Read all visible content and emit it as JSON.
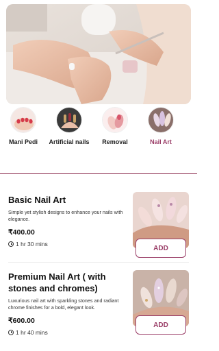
{
  "categories": [
    {
      "label": "Mani Pedi",
      "active": false
    },
    {
      "label": "Artificial nails",
      "active": false
    },
    {
      "label": "Removal",
      "active": false
    },
    {
      "label": "Nail Art",
      "active": true
    }
  ],
  "services": [
    {
      "title": "Basic Nail Art",
      "description": "Simple yet stylish designs to enhance your nails with elegance.",
      "price": "₹400.00",
      "duration": "1 hr 30 mins",
      "add_label": "ADD"
    },
    {
      "title": "Premium Nail Art ( with stones and chromes)",
      "description": "Luxurious nail art with sparkling stones and radiant chrome finishes for a bold, elegant look.",
      "price": "₹600.00",
      "duration": "1 hr 40 mins",
      "add_label": "ADD"
    }
  ],
  "colors": {
    "accent": "#9a3d67",
    "divider": "#8b2a4c"
  }
}
